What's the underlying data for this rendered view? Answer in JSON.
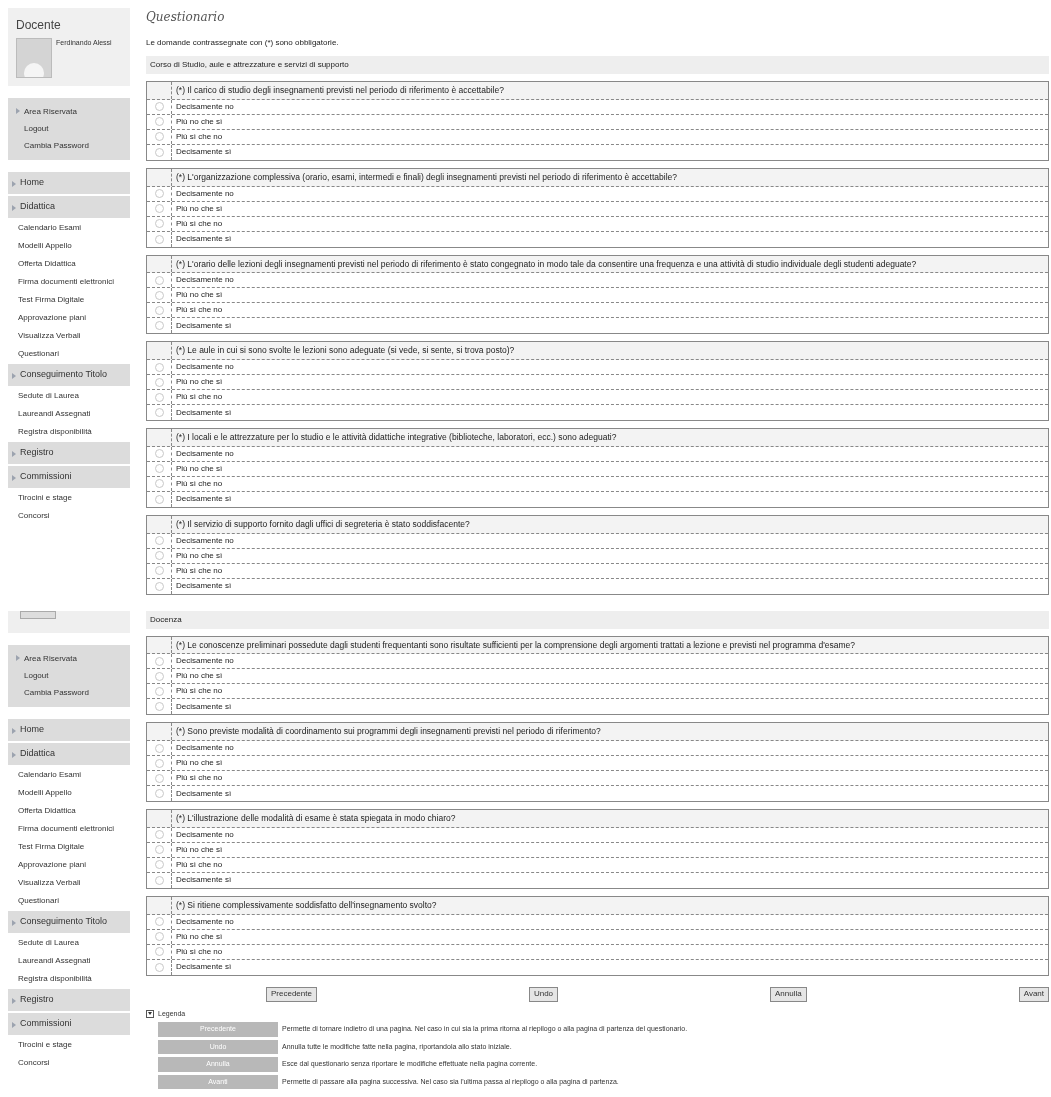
{
  "panels": [
    {
      "sidebar": {
        "profile": {
          "title": "Docente",
          "name": "Ferdinando Alessi"
        },
        "account_box": {
          "title": "Area Riservata",
          "links": [
            "Logout",
            "Cambia Password"
          ]
        },
        "nav": [
          {
            "kind": "header",
            "label": "Home"
          },
          {
            "kind": "header",
            "label": "Didattica"
          },
          {
            "kind": "link",
            "label": "Calendario Esami"
          },
          {
            "kind": "link",
            "label": "Modelli Appello"
          },
          {
            "kind": "link",
            "label": "Offerta Didattica"
          },
          {
            "kind": "link",
            "label": "Firma documenti elettronici"
          },
          {
            "kind": "link",
            "label": "Test Firma Digitale"
          },
          {
            "kind": "link",
            "label": "Approvazione piani"
          },
          {
            "kind": "link",
            "label": "Visualizza Verbali"
          },
          {
            "kind": "link",
            "label": "Questionari"
          },
          {
            "kind": "header",
            "label": "Conseguimento Titolo"
          },
          {
            "kind": "link",
            "label": "Sedute di Laurea"
          },
          {
            "kind": "link",
            "label": "Laureandi Assegnati"
          },
          {
            "kind": "link",
            "label": "Registra disponibilità"
          },
          {
            "kind": "header",
            "label": "Registro"
          },
          {
            "kind": "header",
            "label": "Commissioni"
          },
          {
            "kind": "link",
            "label": "Tirocini e stage"
          },
          {
            "kind": "link",
            "label": "Concorsi"
          }
        ]
      },
      "main": {
        "title": "Questionario",
        "note": "Le domande contrassegnate con (*) sono obbligatorie.",
        "section": "Corso di Studio, aule e attrezzature e servizi di supporto",
        "questions": [
          {
            "text": "(*) Il carico di studio degli insegnamenti previsti nel periodo di riferimento è accettabile?",
            "options": [
              {
                "label": "Decisamente no",
                "selected": false
              },
              {
                "label": "Più no che sì",
                "selected": false
              },
              {
                "label": "Più sì che no",
                "selected": false
              },
              {
                "label": "Decisamente sì",
                "selected": false
              }
            ]
          },
          {
            "text": "(*) L'organizzazione complessiva (orario, esami, intermedi e finali) degli insegnamenti previsti nel periodo di riferimento è accettabile?",
            "options": [
              {
                "label": "Decisamente no",
                "selected": false
              },
              {
                "label": "Più no che sì",
                "selected": false
              },
              {
                "label": "Più sì che no",
                "selected": false
              },
              {
                "label": "Decisamente sì",
                "selected": false
              }
            ]
          },
          {
            "text": "(*) L'orario delle lezioni degli insegnamenti previsti nel periodo di riferimento è stato congegnato in modo tale da consentire una frequenza e una attività di studio individuale degli studenti adeguate?",
            "options": [
              {
                "label": "Decisamente no",
                "selected": false
              },
              {
                "label": "Più no che sì",
                "selected": false
              },
              {
                "label": "Più sì che no",
                "selected": false
              },
              {
                "label": "Decisamente sì",
                "selected": false
              }
            ]
          },
          {
            "text": "(*) Le aule in cui si sono svolte le lezioni sono adeguate (si vede, si sente, si trova posto)?",
            "options": [
              {
                "label": "Decisamente no",
                "selected": false
              },
              {
                "label": "Più no che sì",
                "selected": false
              },
              {
                "label": "Più sì che no",
                "selected": false
              },
              {
                "label": "Decisamente sì",
                "selected": false
              }
            ]
          },
          {
            "text": "(*) I locali e le attrezzature per lo studio e le attività didattiche integrative (biblioteche, laboratori, ecc.) sono adeguati?",
            "options": [
              {
                "label": "Decisamente no",
                "selected": false
              },
              {
                "label": "Più no che sì",
                "selected": false
              },
              {
                "label": "Più sì che no",
                "selected": false
              },
              {
                "label": "Decisamente sì",
                "selected": false
              }
            ]
          },
          {
            "text": "(*) Il servizio di supporto fornito dagli uffici di segreteria è stato soddisfacente?",
            "options": [
              {
                "label": "Decisamente no",
                "selected": false
              },
              {
                "label": "Più no che sì",
                "selected": false
              },
              {
                "label": "Più sì che no",
                "selected": false
              },
              {
                "label": "Decisamente sì",
                "selected": false
              }
            ]
          }
        ]
      }
    },
    {
      "sidebar": {
        "photo": true,
        "account_box": {
          "title": "Area Riservata",
          "links": [
            "Logout",
            "Cambia Password"
          ]
        },
        "nav": [
          {
            "kind": "header",
            "label": "Home"
          },
          {
            "kind": "header",
            "label": "Didattica"
          },
          {
            "kind": "link",
            "label": "Calendario Esami"
          },
          {
            "kind": "link",
            "label": "Modelli Appello"
          },
          {
            "kind": "link",
            "label": "Offerta Didattica"
          },
          {
            "kind": "link",
            "label": "Firma documenti elettronici"
          },
          {
            "kind": "link",
            "label": "Test Firma Digitale"
          },
          {
            "kind": "link",
            "label": "Approvazione piani"
          },
          {
            "kind": "link",
            "label": "Visualizza Verbali"
          },
          {
            "kind": "link",
            "label": "Questionari"
          },
          {
            "kind": "header",
            "label": "Conseguimento Titolo"
          },
          {
            "kind": "link",
            "label": "Sedute di Laurea"
          },
          {
            "kind": "link",
            "label": "Laureandi Assegnati"
          },
          {
            "kind": "link",
            "label": "Registra disponibilità"
          },
          {
            "kind": "header",
            "label": "Registro"
          },
          {
            "kind": "header",
            "label": "Commissioni"
          },
          {
            "kind": "link",
            "label": "Tirocini e stage"
          },
          {
            "kind": "link",
            "label": "Concorsi"
          }
        ]
      },
      "main": {
        "section": "Docenza",
        "questions": [
          {
            "text": "(*) Le conoscenze preliminari possedute dagli studenti frequentanti sono risultate sufficienti per la comprensione degli argomenti trattati a lezione e previsti nel programma d'esame?",
            "options": [
              {
                "label": "Decisamente no",
                "selected": false
              },
              {
                "label": "Più no che sì",
                "selected": false
              },
              {
                "label": "Più sì che no",
                "selected": false
              },
              {
                "label": "Decisamente sì",
                "selected": false
              }
            ]
          },
          {
            "text": "(*) Sono previste modalità di coordinamento sui programmi degli insegnamenti previsti nel periodo di riferimento?",
            "options": [
              {
                "label": "Decisamente no",
                "selected": false
              },
              {
                "label": "Più no che sì",
                "selected": false
              },
              {
                "label": "Più sì che no",
                "selected": false
              },
              {
                "label": "Decisamente sì",
                "selected": false
              }
            ]
          },
          {
            "text": "(*) L'illustrazione delle modalità di esame è stata spiegata in modo chiaro?",
            "options": [
              {
                "label": "Decisamente no",
                "selected": false
              },
              {
                "label": "Più no che sì",
                "selected": false
              },
              {
                "label": "Più sì che no",
                "selected": false
              },
              {
                "label": "Decisamente sì",
                "selected": false
              }
            ]
          },
          {
            "text": "(*) Si ritiene complessivamente soddisfatto dell'insegnamento svolto?",
            "options": [
              {
                "label": "Decisamente no",
                "selected": false
              },
              {
                "label": "Più no che sì",
                "selected": false
              },
              {
                "label": "Più sì che no",
                "selected": false
              },
              {
                "label": "Decisamente sì",
                "selected": false
              }
            ]
          }
        ],
        "buttons": [
          "Precedente",
          "Undo",
          "Annulla",
          "Avant"
        ],
        "legend": {
          "title": "Legenda",
          "rows": [
            {
              "button": "Precedente",
              "description": "Permette di tornare indietro di una pagina. Nel caso in cui sia la prima ritorna al riepilogo o alla pagina di partenza del questionario."
            },
            {
              "button": "Undo",
              "description": "Annulla tutte le modifiche fatte nella pagina, riportandola allo stato iniziale."
            },
            {
              "button": "Annulla",
              "description": "Esce dal questionario senza riportare le modifiche effettuate nella pagina corrente."
            },
            {
              "button": "Avanti",
              "description": "Permette di passare alla pagina successiva. Nel caso sia l'ultima passa al riepilogo o alla pagina di partenza."
            }
          ]
        }
      }
    }
  ]
}
